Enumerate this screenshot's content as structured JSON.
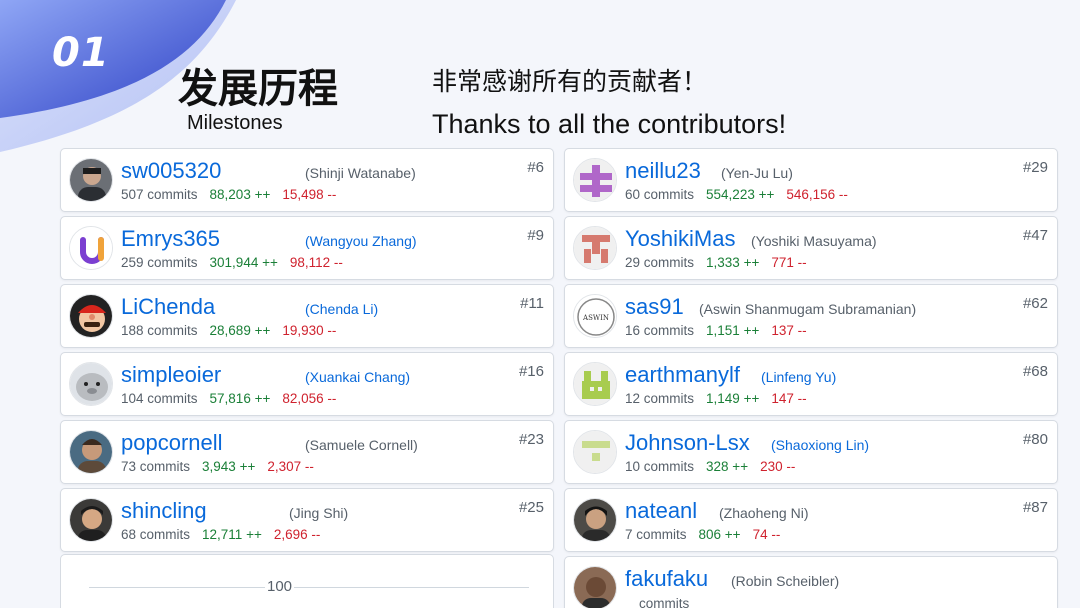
{
  "header": {
    "section_number": "01",
    "title_cn": "发展历程",
    "title_en": "Milestones",
    "thanks_cn": "非常感谢所有的贡献者！",
    "thanks_en": "Thanks to all the contributors!"
  },
  "colors": {
    "link": "#0969da",
    "additions": "#1a7f37",
    "deletions": "#cf222e",
    "accent_gradient": [
      "#5b7cf0",
      "#2f3fc8"
    ]
  },
  "contributors_left": [
    {
      "username": "sw005320",
      "full_name": "(Shinji Watanabe)",
      "rank": "#6",
      "commits": "507 commits",
      "additions": "88,203 ++",
      "deletions": "15,498 --",
      "avatar": "photo-avatar"
    },
    {
      "username": "Emrys365",
      "full_name": "(Wangyou Zhang)",
      "rank": "#9",
      "commits": "259 commits",
      "additions": "301,944 ++",
      "deletions": "98,112 --",
      "avatar": "logo-u-avatar"
    },
    {
      "username": "LiChenda",
      "full_name": "(Chenda Li)",
      "rank": "#11",
      "commits": "188 commits",
      "additions": "28,689 ++",
      "deletions": "19,930 --",
      "avatar": "cartoon-avatar"
    },
    {
      "username": "simpleoier",
      "full_name": "(Xuankai Chang)",
      "rank": "#16",
      "commits": "104 commits",
      "additions": "57,816 ++",
      "deletions": "82,056 --",
      "avatar": "seal-avatar"
    },
    {
      "username": "popcornell",
      "full_name": "(Samuele Cornell)",
      "rank": "#23",
      "commits": "73 commits",
      "additions": "3,943 ++",
      "deletions": "2,307 --",
      "avatar": "photo-avatar"
    },
    {
      "username": "shincling",
      "full_name": "(Jing Shi)",
      "rank": "#25",
      "commits": "68 commits",
      "additions": "12,711 ++",
      "deletions": "2,696 --",
      "avatar": "photo-avatar"
    }
  ],
  "contributors_right": [
    {
      "username": "neillu23",
      "full_name": "(Yen-Ju Lu)",
      "rank": "#29",
      "commits": "60 commits",
      "additions": "554,223 ++",
      "deletions": "546,156 --",
      "avatar": "identicon-avatar"
    },
    {
      "username": "YoshikiMas",
      "full_name": "(Yoshiki Masuyama)",
      "rank": "#47",
      "commits": "29 commits",
      "additions": "1,333 ++",
      "deletions": "771 --",
      "avatar": "identicon-avatar"
    },
    {
      "username": "sas91",
      "full_name": "(Aswin Shanmugam Subramanian)",
      "rank": "#62",
      "commits": "16 commits",
      "additions": "1,151 ++",
      "deletions": "137 --",
      "avatar": "aswin-logo-avatar",
      "avatar_text": "ASWIN"
    },
    {
      "username": "earthmanylf",
      "full_name": "(Linfeng Yu)",
      "rank": "#68",
      "commits": "12 commits",
      "additions": "1,149 ++",
      "deletions": "147 --",
      "avatar": "identicon-avatar"
    },
    {
      "username": "Johnson-Lsx",
      "full_name": "(Shaoxiong Lin)",
      "rank": "#80",
      "commits": "10 commits",
      "additions": "328 ++",
      "deletions": "230 --",
      "avatar": "identicon-avatar"
    },
    {
      "username": "nateanl",
      "full_name": "(Zhaoheng Ni)",
      "rank": "#87",
      "commits": "7 commits",
      "additions": "806 ++",
      "deletions": "74 --",
      "avatar": "photo-avatar"
    },
    {
      "username": "fakufaku",
      "full_name": "(Robin Scheibler)",
      "commits": "commits",
      "avatar": "photo-avatar"
    }
  ],
  "chart_fragment": {
    "tick_label": "100"
  }
}
